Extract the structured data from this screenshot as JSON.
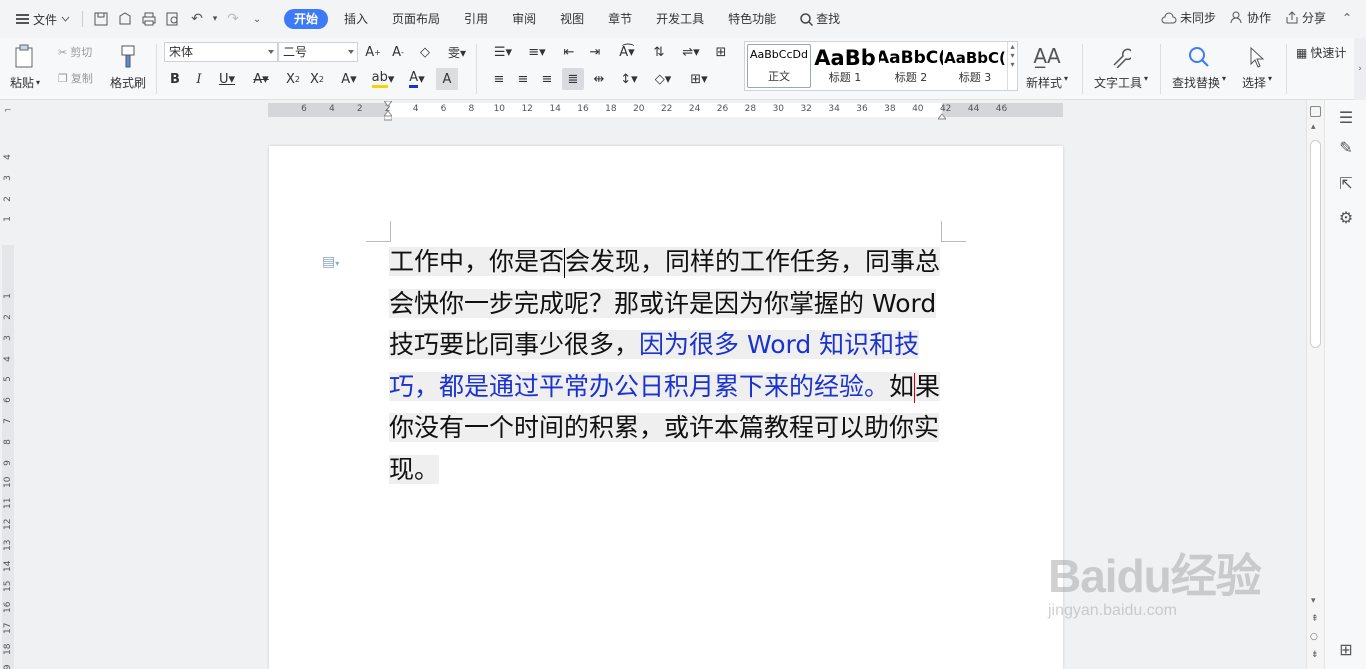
{
  "titlebar": {
    "file_menu": "文件",
    "tabs": [
      "开始",
      "插入",
      "页面布局",
      "引用",
      "审阅",
      "视图",
      "章节",
      "开发工具",
      "特色功能"
    ],
    "search": "查找",
    "sync": "未同步",
    "collab": "协作",
    "share": "分享"
  },
  "ribbon": {
    "paste": "粘贴",
    "cut": "剪切",
    "copy": "复制",
    "format_painter": "格式刷",
    "font_name": "宋体",
    "font_size": "二号",
    "styles": [
      {
        "preview": "AaBbCcDd",
        "name": "正文"
      },
      {
        "preview": "AaBb",
        "name": "标题 1"
      },
      {
        "preview": "AaBbC(",
        "name": "标题 2"
      },
      {
        "preview": "AaBbC(",
        "name": "标题 3"
      }
    ],
    "new_style": "新样式",
    "text_tools": "文字工具",
    "find_replace": "查找替换",
    "select": "选择",
    "quick_calc": "快速计"
  },
  "ruler": {
    "h_ticks": [
      "6",
      "4",
      "2",
      "2",
      "4",
      "6",
      "8",
      "10",
      "12",
      "14",
      "16",
      "18",
      "20",
      "22",
      "24",
      "26",
      "28",
      "30",
      "32",
      "34",
      "36",
      "38",
      "40",
      "42",
      "44",
      "46"
    ],
    "v_ticks": [
      "4",
      "3",
      "2",
      "1",
      "1",
      "2",
      "3",
      "4",
      "5",
      "6",
      "7",
      "8",
      "9",
      "10",
      "11",
      "12",
      "13",
      "14",
      "15",
      "16",
      "17",
      "18",
      "19"
    ]
  },
  "document": {
    "p1": "工作中，你是否",
    "p2": "会发现，同样的工作任务，同事总会快你一步完成呢？那或许是因为你掌握的 Word 技巧要比同事少很多，",
    "p3_blue": "因为很多 Word 知识和技巧，都是通过平常办公日积月累下来的经验。",
    "p4": "如",
    "p5": "果你没有一个时间的积累，或许本篇教程可以助你实现。"
  },
  "watermark": {
    "line1": "Baidu经验",
    "line2": "jingyan.baidu.com"
  }
}
